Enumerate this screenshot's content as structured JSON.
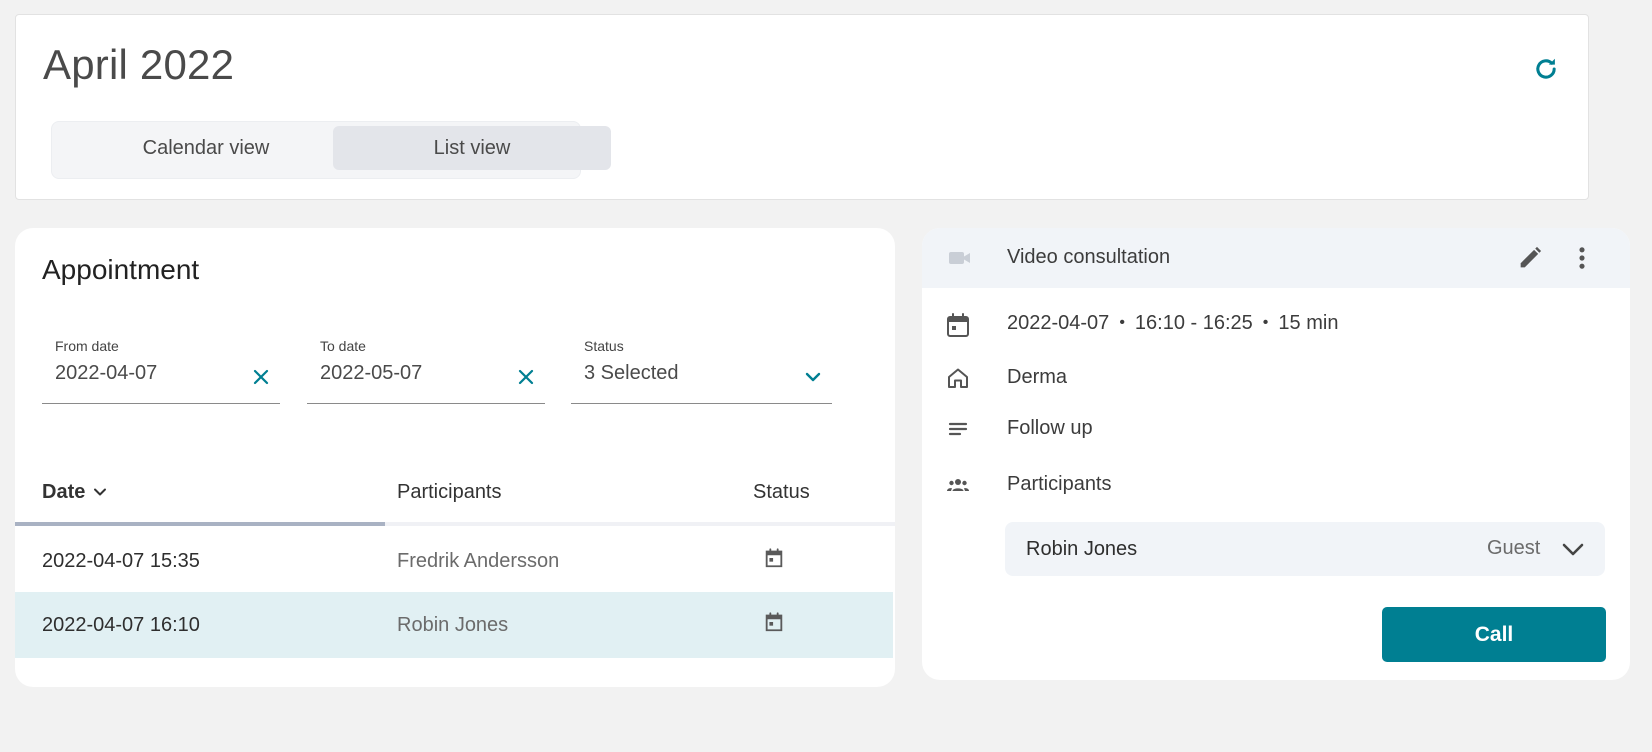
{
  "header": {
    "title": "April 2022",
    "refresh_icon": "refresh-icon",
    "view_tabs": [
      {
        "label": "Calendar view",
        "selected": false
      },
      {
        "label": "List view",
        "selected": true
      }
    ]
  },
  "appointments": {
    "title": "Appointment",
    "filters": {
      "from_date": {
        "label": "From date",
        "value": "2022-04-07"
      },
      "to_date": {
        "label": "To date",
        "value": "2022-05-07"
      },
      "status": {
        "label": "Status",
        "value": "3 Selected"
      }
    },
    "columns": {
      "date": "Date",
      "participants": "Participants",
      "status": "Status"
    },
    "rows": [
      {
        "date": "2022-04-07 15:35",
        "participant": "Fredrik Andersson",
        "status_icon": "calendar-icon",
        "selected": false
      },
      {
        "date": "2022-04-07 16:10",
        "participant": "Robin Jones",
        "status_icon": "calendar-icon",
        "selected": true
      }
    ]
  },
  "detail": {
    "type": "Video consultation",
    "date": "2022-04-07",
    "time": "16:10 - 16:25",
    "duration": "15 min",
    "separator": "•",
    "department": "Derma",
    "reason": "Follow up",
    "participants_label": "Participants",
    "participants": [
      {
        "name": "Robin Jones",
        "role": "Guest"
      }
    ],
    "call_label": "Call"
  },
  "colors": {
    "accent": "#007f92",
    "selected_row": "#e1f0f3",
    "background": "#f2f2f2"
  }
}
